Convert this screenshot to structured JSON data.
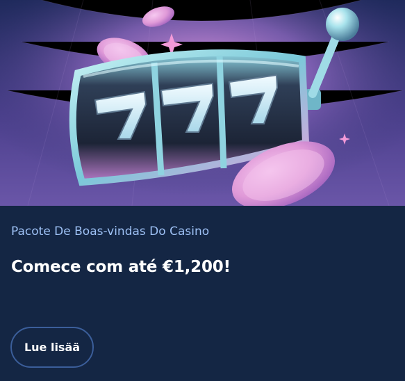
{
  "banner": {
    "image": "slot-machine-777-banner",
    "reel_symbols": [
      "7",
      "7",
      "7"
    ],
    "colors": {
      "background_top": "#2b2f6b",
      "background_glow": "#c57bd8",
      "coin": "#e6a6dc"
    }
  },
  "promo": {
    "subtitle": "Pacote De Boas-vindas Do Casino",
    "headline": "Comece com até €1,200!",
    "cta_label": "Lue lisää"
  },
  "colors": {
    "card_background": "#142644",
    "subtitle": "#9ec1f5",
    "button_border": "#3b5e9a"
  }
}
